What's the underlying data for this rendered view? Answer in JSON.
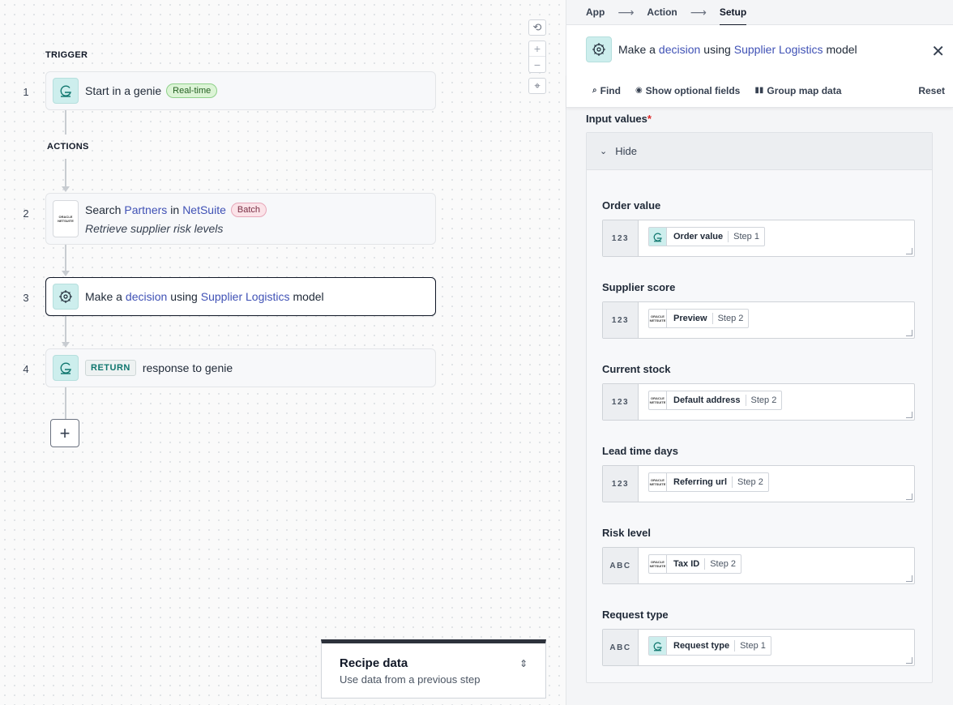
{
  "canvas": {
    "trigger_label": "TRIGGER",
    "actions_label": "ACTIONS",
    "steps": [
      {
        "num": "1",
        "prefix": "Start in a genie",
        "badge": "Real-time"
      },
      {
        "num": "2",
        "prefix": "Search",
        "object": "Partners",
        "mid": "in",
        "app": "NetSuite",
        "badge": "Batch",
        "subtitle": "Retrieve supplier risk levels"
      },
      {
        "num": "3",
        "prefix": "Make a",
        "object": "decision",
        "mid": "using",
        "model": "Supplier Logistics",
        "suffix": "model"
      },
      {
        "num": "4",
        "tag": "RETURN",
        "suffix": "response to genie"
      }
    ],
    "add_button": "+",
    "zoom": {
      "reset": "⟲",
      "in": "+",
      "out": "−",
      "fit": "⌖"
    }
  },
  "recipe_data": {
    "title": "Recipe data",
    "subtitle": "Use data from a previous step",
    "expand_icon": "⇕"
  },
  "panel": {
    "breadcrumbs": [
      "App",
      "Action",
      "Setup"
    ],
    "crumb_arrow": "⟶",
    "header": {
      "prefix": "Make a",
      "object": "decision",
      "mid": "using",
      "model": "Supplier Logistics",
      "suffix": "model"
    },
    "close": "✕",
    "toolbar": {
      "find": "Find",
      "optional": "Show optional fields",
      "group": "Group map data",
      "reset": "Reset"
    },
    "input_values_label": "Input values",
    "required_mark": "*",
    "hide_label": "Hide",
    "fields": [
      {
        "label": "Order value",
        "type": "123",
        "pill": "Order value",
        "step": "Step 1",
        "source": "genie"
      },
      {
        "label": "Supplier score",
        "type": "123",
        "pill": "Preview",
        "step": "Step 2",
        "source": "netsuite"
      },
      {
        "label": "Current stock",
        "type": "123",
        "pill": "Default address",
        "step": "Step 2",
        "source": "netsuite"
      },
      {
        "label": "Lead time days",
        "type": "123",
        "pill": "Referring url",
        "step": "Step 2",
        "source": "netsuite"
      },
      {
        "label": "Risk level",
        "type": "ABC",
        "pill": "Tax ID",
        "step": "Step 2",
        "source": "netsuite"
      },
      {
        "label": "Request type",
        "type": "ABC",
        "pill": "Request type",
        "step": "Step 1",
        "source": "genie"
      }
    ]
  },
  "colors": {
    "accent_link": "#3f51b5",
    "genie_teal": "#cdeeed",
    "badge_green": "#dcf4d6",
    "badge_pink": "#fbe3e8"
  }
}
